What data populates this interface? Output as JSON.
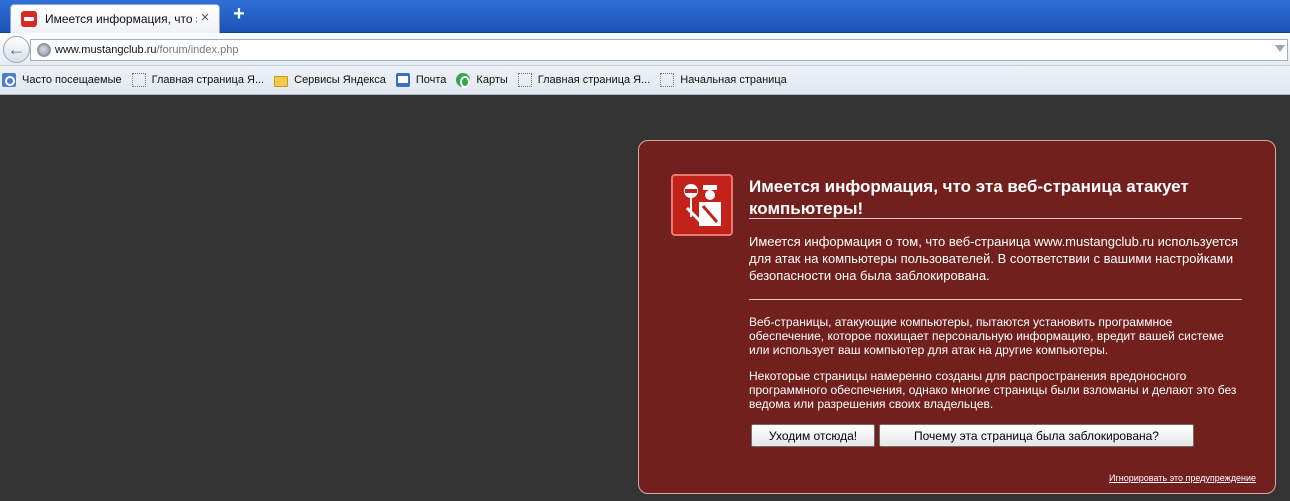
{
  "tab": {
    "title": "Имеется информация, что э...",
    "close_glyph": "×",
    "new_tab_glyph": "+"
  },
  "navbar": {
    "back_glyph": "←",
    "url_host": "www.mustangclub.ru",
    "url_path": "/forum/index.php"
  },
  "bookmarks": [
    {
      "label": "Часто посещаемые",
      "icon": "most-visited-icon"
    },
    {
      "label": "Главная страница Я...",
      "icon": "page-icon"
    },
    {
      "label": "Сервисы Яндекса",
      "icon": "folder-icon"
    },
    {
      "label": "Почта",
      "icon": "mail-icon"
    },
    {
      "label": "Карты",
      "icon": "maps-icon"
    },
    {
      "label": "Главная страница Я...",
      "icon": "page-icon"
    },
    {
      "label": "Начальная страница",
      "icon": "page-icon"
    }
  ],
  "warning": {
    "title": "Имеется информация, что эта веб-страница атакует компьютеры!",
    "lead": "Имеется информация о том, что веб-страница www.mustangclub.ru используется для атак на компьютеры пользователей. В соответствии с вашими настройками безопасности она была заблокирована.",
    "paragraph1": "Веб-страницы, атакующие компьютеры, пытаются установить программное обеспечение, которое похищает персональную информацию, вредит вашей системе или использует ваш компьютер для атак на другие компьютеры.",
    "paragraph2": "Некоторые страницы намеренно созданы для распространения вредоносного программного обеспечения, однако многие страницы были взломаны и делают это без ведома или разрешения своих владельцев.",
    "get_out_label": "Уходим отсюда!",
    "why_label": "Почему эта страница была заблокирована?",
    "ignore_label": "Игнорировать это предупреждение"
  },
  "colors": {
    "page_bg": "#343434",
    "warning_bg": "#72201e",
    "shield_red": "#c3221b"
  }
}
